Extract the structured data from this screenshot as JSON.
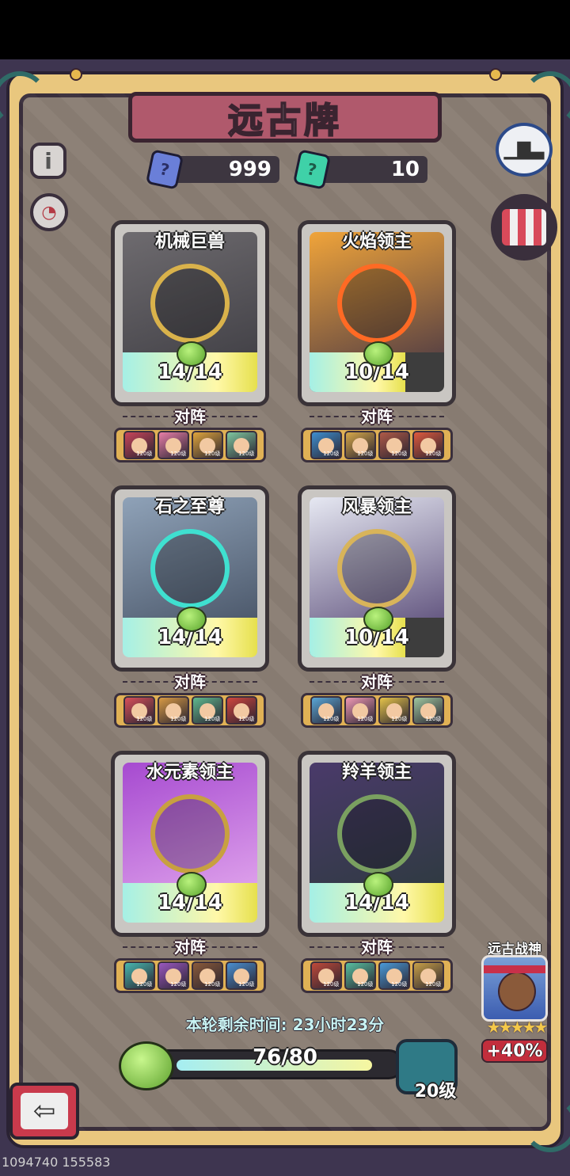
{
  "title": "远古牌",
  "resources": [
    {
      "name": "blue-gem",
      "value": "999",
      "color": "#6a7fd8",
      "glyph": "?"
    },
    {
      "name": "green-gem",
      "value": "10",
      "color": "#3fd1a8",
      "glyph": "?"
    }
  ],
  "lineup_label": "对阵",
  "cards": [
    {
      "name": "机械巨兽",
      "progress": "14/14",
      "fill": 1.0,
      "art": [
        "#6e6b6f",
        "#3b3a40"
      ],
      "accent": "#d9b24b",
      "heroes": [
        "#c9455a",
        "#e87ea8",
        "#e0a53c",
        "#7fc7a0"
      ]
    },
    {
      "name": "火焰领主",
      "progress": "10/14",
      "fill": 0.714,
      "art": [
        "#f0a43a",
        "#3c2f45"
      ],
      "accent": "#ff6a24",
      "heroes": [
        "#3f8fd0",
        "#d8a94a",
        "#b05a48",
        "#e05a3e"
      ]
    },
    {
      "name": "石之至尊",
      "progress": "14/14",
      "fill": 1.0,
      "art": [
        "#8fa2b8",
        "#3f4a5c"
      ],
      "accent": "#3fe0d0",
      "heroes": [
        "#d8505a",
        "#d89a45",
        "#5fb98f",
        "#d0463f"
      ]
    },
    {
      "name": "风暴领主",
      "progress": "10/14",
      "fill": 0.714,
      "art": [
        "#e6e8f2",
        "#4a3a6a"
      ],
      "accent": "#d8b45a",
      "heroes": [
        "#5aa7d8",
        "#f09ab5",
        "#e6c44a",
        "#9fc7a0"
      ]
    },
    {
      "name": "水元素领主",
      "progress": "14/14",
      "fill": 1.0,
      "art": [
        "#a64ad0",
        "#e8b0f0"
      ],
      "accent": "#c8a040",
      "heroes": [
        "#48b8b0",
        "#9a58c0",
        "#8a5a3a",
        "#4a8fd0"
      ]
    },
    {
      "name": "羚羊领主",
      "progress": "14/14",
      "fill": 1.0,
      "art": [
        "#4a3a6a",
        "#2a3a3a"
      ],
      "accent": "#7aa060",
      "heroes": [
        "#c04a3a",
        "#58c0a0",
        "#4a9ad8",
        "#c8a048"
      ]
    }
  ],
  "hero_level": "120级",
  "timer": "本轮剩余时间: 23小时23分",
  "progress": {
    "text": "76/80",
    "fill": 0.95
  },
  "chest_level": "20级",
  "bonus": {
    "title": "远古战神",
    "stars": "★★★★★",
    "percent": "+40%"
  },
  "side_buttons": {
    "info": "i",
    "ranking": "1",
    "shop": "shop"
  },
  "watermark": "1094740 155583"
}
